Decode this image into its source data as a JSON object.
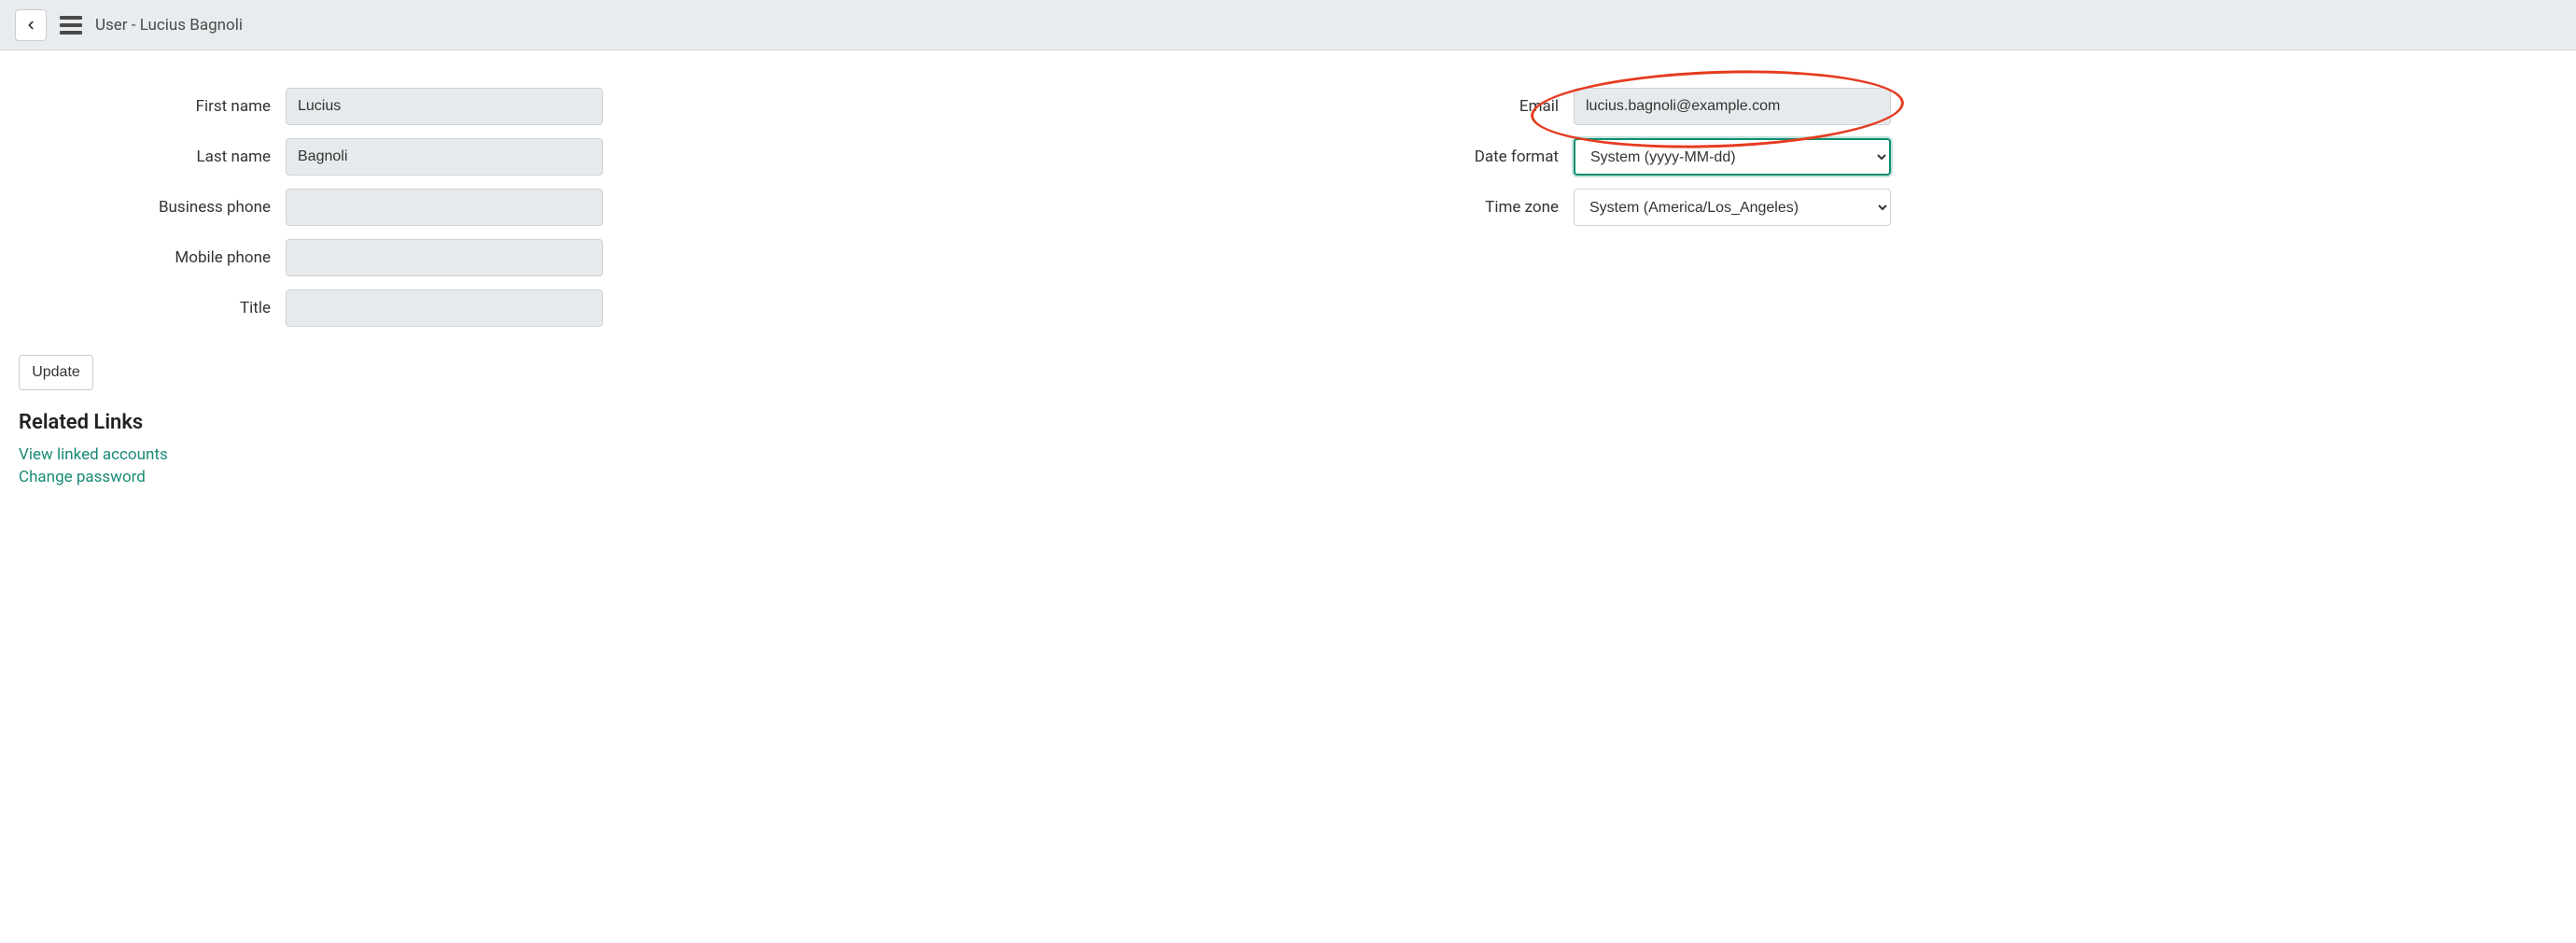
{
  "header": {
    "title": "User - Lucius Bagnoli"
  },
  "form": {
    "left": {
      "first_name": {
        "label": "First name",
        "value": "Lucius"
      },
      "last_name": {
        "label": "Last name",
        "value": "Bagnoli"
      },
      "business_phone": {
        "label": "Business phone",
        "value": ""
      },
      "mobile_phone": {
        "label": "Mobile phone",
        "value": ""
      },
      "title": {
        "label": "Title",
        "value": ""
      }
    },
    "right": {
      "email": {
        "label": "Email",
        "value": "lucius.bagnoli@example.com"
      },
      "date_format": {
        "label": "Date format",
        "value": "System (yyyy-MM-dd)"
      },
      "time_zone": {
        "label": "Time zone",
        "value": "System (America/Los_Angeles)"
      }
    }
  },
  "buttons": {
    "update": "Update"
  },
  "related_links": {
    "heading": "Related Links",
    "items": [
      "View linked accounts",
      "Change password"
    ]
  }
}
